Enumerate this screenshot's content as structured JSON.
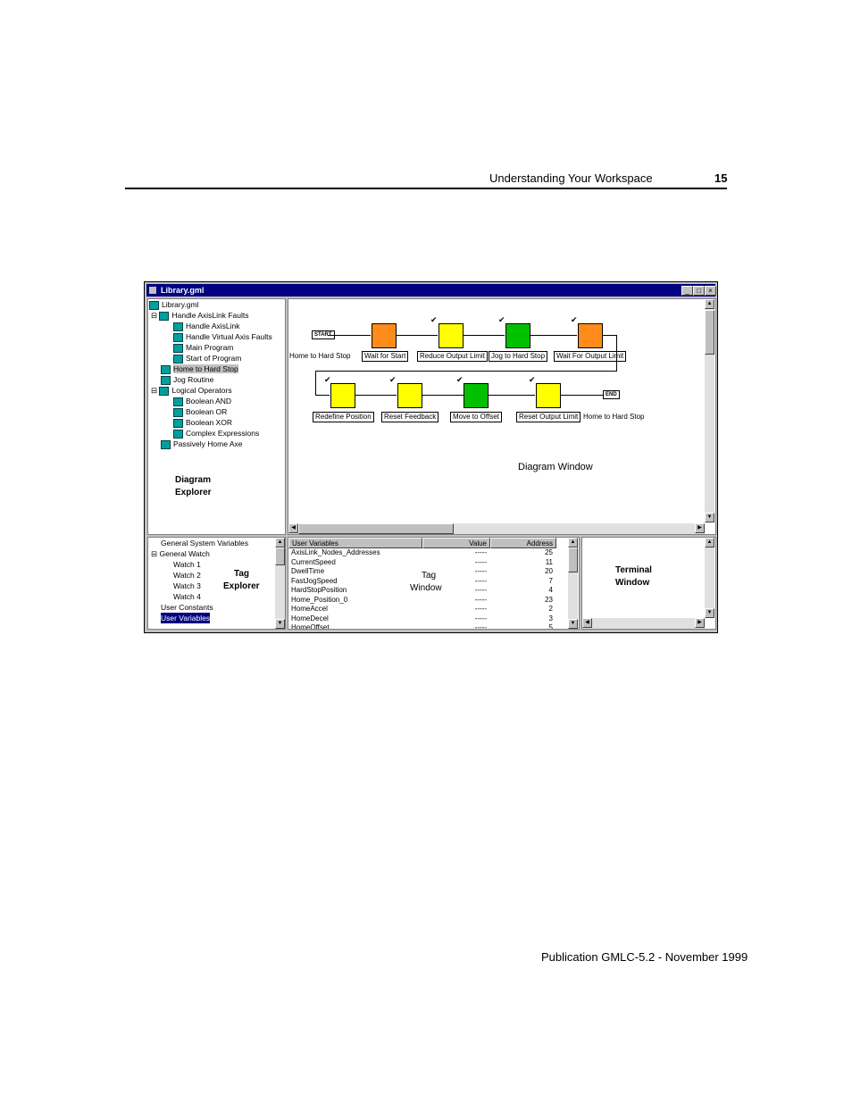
{
  "header": {
    "title": "Understanding Your Workspace",
    "page_number": "15"
  },
  "footer": {
    "publication": "Publication GMLC-5.2 - November 1999"
  },
  "window": {
    "title": "Library.gml",
    "controls": [
      "_",
      "□",
      "×"
    ]
  },
  "explorer": {
    "items": [
      {
        "label": "Library.gml",
        "level": 0
      },
      {
        "label": "Handle AxisLink Faults",
        "level": 1
      },
      {
        "label": "Handle AxisLink",
        "level": 2
      },
      {
        "label": "Handle Virtual Axis Faults",
        "level": 2
      },
      {
        "label": "Main Program",
        "level": 2
      },
      {
        "label": "Start of Program",
        "level": 2
      },
      {
        "label": "Home to Hard Stop",
        "level": 1
      },
      {
        "label": "Jog Routine",
        "level": 1
      },
      {
        "label": "Logical Operators",
        "level": 1
      },
      {
        "label": "Boolean AND",
        "level": 2
      },
      {
        "label": "Boolean OR",
        "level": 2
      },
      {
        "label": "Boolean XOR",
        "level": 2
      },
      {
        "label": "Complex Expressions",
        "level": 2
      },
      {
        "label": "Passively Home Axe",
        "level": 1
      }
    ],
    "caption_line1": "Diagram",
    "caption_line2": "Explorer"
  },
  "diagram": {
    "start_label": "START",
    "end_label": "END",
    "row1_caption": "Home to Hard Stop",
    "row2_caption": "Home to Hard Stop",
    "blocks_row1": [
      "Wait for Start",
      "Reduce Output Limit",
      "Jog to Hard Stop",
      "Wait For Output Limit"
    ],
    "blocks_row2": [
      "Redefine Position",
      "Reset Feedback",
      "Move to Offset",
      "Reset Output Limit"
    ],
    "caption": "Diagram Window",
    "colors": {
      "orange": "#ff8c1a",
      "yellow": "#ffff00",
      "green": "#00c000"
    }
  },
  "tag_explorer": {
    "items": [
      "General System Variables",
      "General Watch",
      "Watch 1",
      "Watch 2",
      "Watch 3",
      "Watch 4",
      "User Constants",
      "User Variables"
    ],
    "caption_line1": "Tag",
    "caption_line2": "Explorer"
  },
  "tag_window": {
    "columns": [
      "User Variables",
      "Value",
      "Address"
    ],
    "rows": [
      {
        "name": "AxisLink_Nodes_Addresses",
        "value": "-----",
        "address": "25"
      },
      {
        "name": "CurrentSpeed",
        "value": "-----",
        "address": "11"
      },
      {
        "name": "DwellTime",
        "value": "-----",
        "address": "20"
      },
      {
        "name": "FastJogSpeed",
        "value": "-----",
        "address": "7"
      },
      {
        "name": "HardStopPosition",
        "value": "-----",
        "address": "4"
      },
      {
        "name": "Home_Position_0",
        "value": "-----",
        "address": "23"
      },
      {
        "name": "HomeAccel",
        "value": "-----",
        "address": "2"
      },
      {
        "name": "HomeDecel",
        "value": "-----",
        "address": "3"
      },
      {
        "name": "HomeOffset",
        "value": "-----",
        "address": "5"
      }
    ],
    "caption_line1": "Tag",
    "caption_line2": "Window"
  },
  "terminal": {
    "caption_line1": "Terminal",
    "caption_line2": "Window"
  }
}
